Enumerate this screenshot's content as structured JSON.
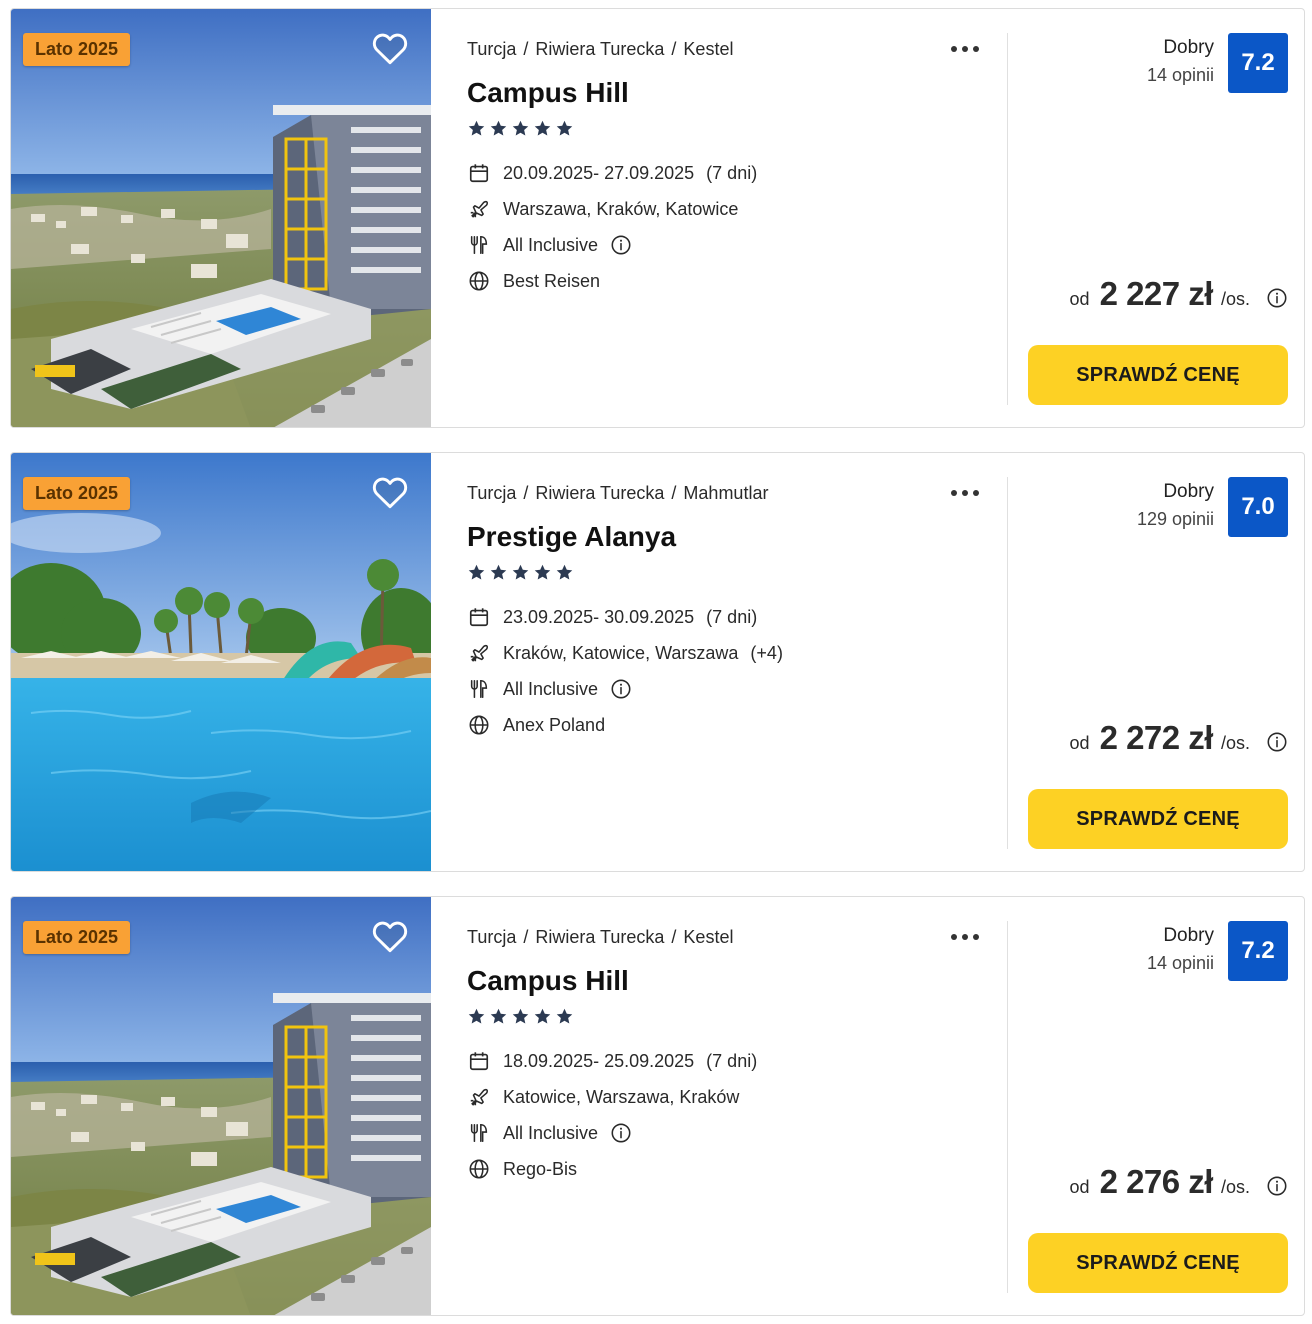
{
  "offers": [
    {
      "badge": "Lato 2025",
      "photo": "hotel-tower-sea-view",
      "breadcrumb": [
        "Turcja",
        "Riwiera Turecka",
        "Kestel"
      ],
      "name": "Campus Hill",
      "stars": 5,
      "dates": "20.09.2025- 27.09.2025",
      "duration": "(7 dni)",
      "airports": "Warszawa, Kraków, Katowice",
      "airports_extra": "",
      "board": "All Inclusive",
      "operator": "Best Reisen",
      "rating_label": "Dobry",
      "reviews": "14 opinii",
      "score": "7.2",
      "price_from": "od",
      "price": "2 227 zł",
      "price_unit": "/os.",
      "cta": "SPRAWDŹ CENĘ"
    },
    {
      "badge": "Lato 2025",
      "photo": "hotel-pool-waterslides",
      "breadcrumb": [
        "Turcja",
        "Riwiera Turecka",
        "Mahmutlar"
      ],
      "name": "Prestige Alanya",
      "stars": 5,
      "dates": "23.09.2025- 30.09.2025",
      "duration": "(7 dni)",
      "airports": "Kraków, Katowice, Warszawa",
      "airports_extra": "(+4)",
      "board": "All Inclusive",
      "operator": "Anex Poland",
      "rating_label": "Dobry",
      "reviews": "129 opinii",
      "score": "7.0",
      "price_from": "od",
      "price": "2 272 zł",
      "price_unit": "/os.",
      "cta": "SPRAWDŹ CENĘ"
    },
    {
      "badge": "Lato 2025",
      "photo": "hotel-tower-sea-view",
      "breadcrumb": [
        "Turcja",
        "Riwiera Turecka",
        "Kestel"
      ],
      "name": "Campus Hill",
      "stars": 5,
      "dates": "18.09.2025- 25.09.2025",
      "duration": "(7 dni)",
      "airports": "Katowice, Warszawa, Kraków",
      "airports_extra": "",
      "board": "All Inclusive",
      "operator": "Rego-Bis",
      "rating_label": "Dobry",
      "reviews": "14 opinii",
      "score": "7.2",
      "price_from": "od",
      "price": "2 276 zł",
      "price_unit": "/os.",
      "cta": "SPRAWDŹ CENĘ"
    }
  ],
  "icons": {
    "favorite": "heart-outline-icon",
    "more": "more-dots-icon",
    "star": "star-icon",
    "dates": "calendar-icon",
    "airports": "plane-icon",
    "board": "cutlery-icon",
    "operator": "globe-icon",
    "info": "info-circle-icon"
  },
  "colors": {
    "badge_bg": "#f9a135",
    "score_bg": "#0b57c7",
    "cta_bg": "#fdd124",
    "star": "#2c3a52"
  }
}
